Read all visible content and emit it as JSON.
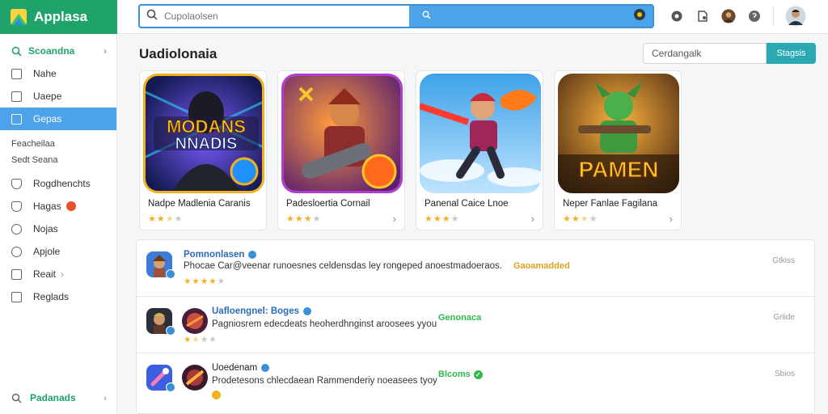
{
  "app": {
    "name": "Applasa"
  },
  "search": {
    "placeholder": "Cupolaolsen"
  },
  "sidebar": {
    "header": "Scoandna",
    "items": [
      {
        "label": "Nahe"
      },
      {
        "label": "Uaepe"
      },
      {
        "label": "Gepas",
        "active": true
      }
    ],
    "section_title": "Feacheilaa",
    "section_sub": "Sedt Seana",
    "items2": [
      {
        "label": "Rogdhenchts"
      },
      {
        "label": "Hagas"
      },
      {
        "label": "Nojas"
      },
      {
        "label": "Apjole"
      },
      {
        "label": "Reait"
      },
      {
        "label": "Reglads"
      }
    ],
    "footer": "Padanads"
  },
  "main": {
    "title": "Uadiolonaia",
    "filter_placeholder": "Cerdangalk",
    "filter_button": "Stagsis"
  },
  "featured": [
    {
      "name": "Nadpe Madlenia Caranis",
      "art_text": "MODANS NNADIS",
      "rating": 2.5
    },
    {
      "name": "Padesloertia Cornail",
      "rating": 3
    },
    {
      "name": "Panenal Caice Lnoe",
      "rating": 3
    },
    {
      "name": "Neper Fanlae Fagilana",
      "art_text": "PAMEN",
      "rating": 2.5
    }
  ],
  "list": [
    {
      "title": "Pomnonlasen",
      "desc": "Phocae  Car@veenar runoesnes celdensdas ley rongeped anoestmadoeraos.",
      "tag": "Gaoamadded",
      "tag_color": "#d9a21e",
      "meta": "Gtkiss",
      "rating": 4
    },
    {
      "title": "Uafloengnel: Boges",
      "desc": "Pagniosrem edecdeats heoherdhnginst aroosees yyou",
      "tag": "Genonaca",
      "tag_color": "#2fb84d",
      "meta": "Griide",
      "rating": 2
    },
    {
      "title": "Uoedenam",
      "desc": "Prodetesons chlecdaean Rammenderiy noeasees tyoy",
      "tag": "Blcoms",
      "tag_color": "#2fb84d",
      "meta": "Sbios",
      "rating": 0
    }
  ],
  "colors": {
    "brand": "#1fa36b",
    "accent": "#4da3ea",
    "button": "#2aa9b3"
  }
}
